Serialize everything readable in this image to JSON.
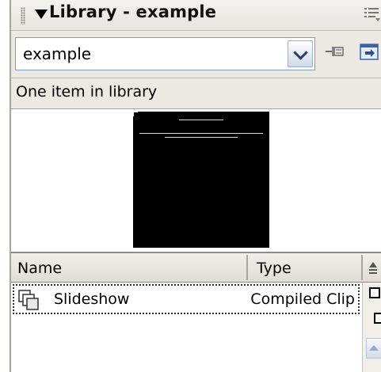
{
  "panel": {
    "title": "Library - example"
  },
  "library_selector": {
    "value": "example"
  },
  "status": {
    "item_count_text": "One item in library"
  },
  "columns": {
    "name": "Name",
    "type": "Type"
  },
  "items": [
    {
      "name": "Slideshow",
      "type": "Compiled Clip",
      "icon": "compiled-clip-icon"
    }
  ],
  "colors": {
    "panel_bg": "#d6d3ce",
    "preview_bg": "#000000",
    "selection_border": "#333333"
  }
}
